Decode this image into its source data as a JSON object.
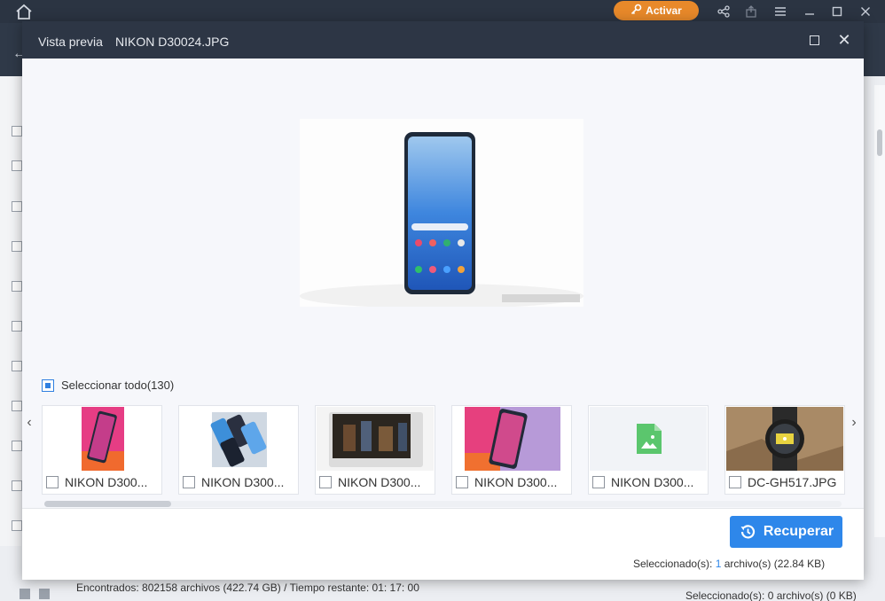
{
  "app": {
    "activate_label": "Activar",
    "found_text": "Encontrados: 802158 archivos (422.74 GB) / Tiempo restante: 01: 17: 00",
    "bg_selected_text": "Seleccionado(s): 0 archivo(s) (0 KB)"
  },
  "modal": {
    "label": "Vista previa",
    "filename": "NIKON D30024.JPG"
  },
  "select_all": {
    "label": "Seleccionar todo(130)",
    "checked": true
  },
  "thumbnails": [
    {
      "name": "NIKON D300...",
      "kind": "phone-pink",
      "checked": false
    },
    {
      "name": "NIKON D300...",
      "kind": "phones-blue",
      "checked": false
    },
    {
      "name": "NIKON D300...",
      "kind": "tablet",
      "checked": false
    },
    {
      "name": "NIKON D300...",
      "kind": "phone-pink-large",
      "checked": false
    },
    {
      "name": "NIKON D300...",
      "kind": "image-placeholder",
      "checked": false
    },
    {
      "name": "DC-GH517.JPG",
      "kind": "watch",
      "checked": false
    }
  ],
  "footer": {
    "recover_label": "Recuperar",
    "summary_prefix": "Seleccionado(s): ",
    "summary_count": "1",
    "summary_suffix": " archivo(s) (22.84 KB)"
  },
  "colors": {
    "header": "#2d3645",
    "accent": "#2e87ea",
    "activate": "#e8892a"
  }
}
